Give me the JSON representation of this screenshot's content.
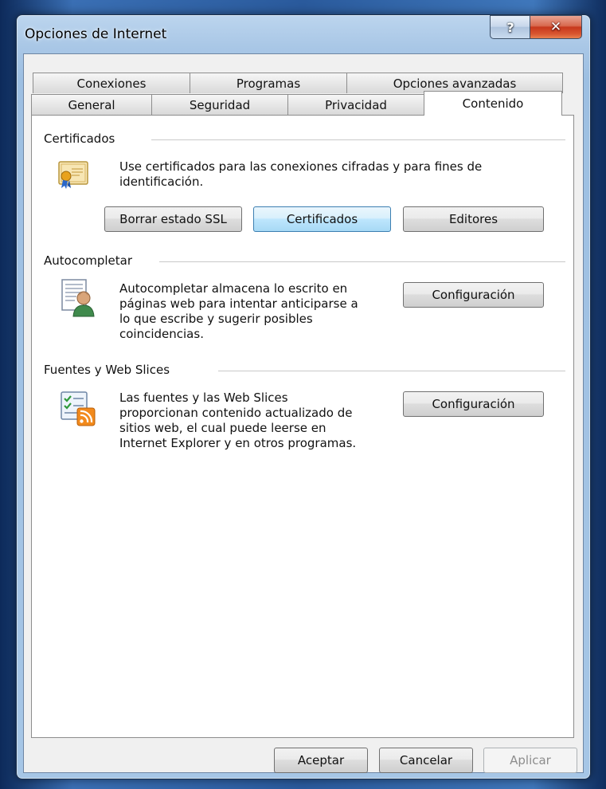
{
  "window": {
    "title": "Opciones de Internet",
    "help_glyph": "?",
    "close_glyph": "✕"
  },
  "tabs": {
    "row1": [
      "Conexiones",
      "Programas",
      "Opciones avanzadas"
    ],
    "row2": [
      "General",
      "Seguridad",
      "Privacidad",
      "Contenido"
    ],
    "active": "Contenido"
  },
  "certificados": {
    "label": "Certificados",
    "icon": "certificate-icon",
    "description_line1": "Use certificados para las conexiones cifradas y para fines de",
    "description_line2": "identificación.",
    "buttons": [
      "Borrar estado SSL",
      "Certificados",
      "Editores"
    ]
  },
  "autocompletar": {
    "label": "Autocompletar",
    "icon": "autocomplete-user-icon",
    "lines": [
      "Autocompletar almacena lo escrito en",
      "páginas web para intentar anticiparse a",
      "lo que escribe y sugerir posibles",
      "coincidencias."
    ],
    "button": "Configuración"
  },
  "fuentes": {
    "label": "Fuentes y Web Slices",
    "icon": "feeds-icon",
    "lines": [
      "Las fuentes y las Web Slices",
      "proporcionan contenido actualizado de",
      "sitios web, el cual puede leerse en",
      "Internet Explorer y en otros programas."
    ],
    "button": "Configuración"
  },
  "footer": {
    "ok": "Aceptar",
    "cancel": "Cancelar",
    "apply": "Aplicar"
  }
}
